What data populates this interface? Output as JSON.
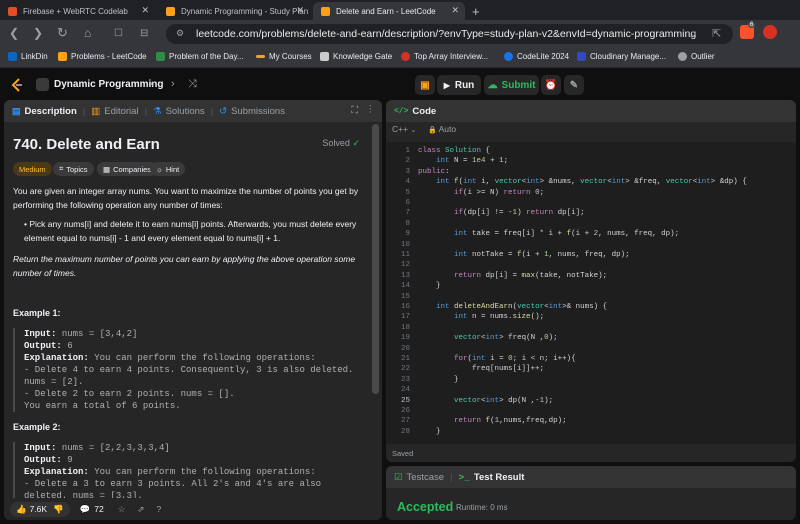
{
  "browser": {
    "tabs": [
      {
        "title": "Firebase + WebRTC Codelab",
        "color": "#e44d26"
      },
      {
        "title": "Dynamic Programming - Study Plan",
        "color": "#ffa116"
      },
      {
        "title": "Delete and Earn - LeetCode",
        "color": "#ffa116"
      }
    ],
    "new_tab": "+",
    "url": "leetcode.com/problems/delete-and-earn/description/?envType=study-plan-v2&envId=dynamic-programming",
    "bookmarks": [
      {
        "label": "LinkDin",
        "color": "#0a66c2"
      },
      {
        "label": "Problems - LeetCode",
        "color": "#ffa116"
      },
      {
        "label": "Problem of the Day...",
        "color": "#2f8d46"
      },
      {
        "label": "My Courses",
        "color": "#e8a33d"
      },
      {
        "label": "Knowledge Gate",
        "color": "#cccccc"
      },
      {
        "label": "Top Array Interview...",
        "color": "#d93025"
      },
      {
        "label": "CodeLite 2024",
        "color": "#1a73e8"
      },
      {
        "label": "Cloudinary Manage...",
        "color": "#3448c5"
      },
      {
        "label": "Outlier",
        "color": "#9aa0a6"
      }
    ],
    "ext_badge": "6"
  },
  "header": {
    "list_name": "Dynamic Programming",
    "run_label": "Run",
    "submit_label": "Submit"
  },
  "desc_panel": {
    "tabs": [
      "Description",
      "Editorial",
      "Solutions",
      "Submissions"
    ],
    "title": "740. Delete and Earn",
    "solved": "Solved",
    "tags": [
      "Medium",
      "Topics",
      "Companies",
      "Hint"
    ],
    "footer": {
      "likes": "7.6K",
      "comments": "72"
    }
  },
  "code_panel": {
    "title": "Code",
    "language": "C++",
    "mode": "Auto",
    "saved": "Saved"
  },
  "result_panel": {
    "tabs": [
      "Testcase",
      "Test Result"
    ],
    "status": "Accepted",
    "runtime": "Runtime: 0 ms"
  }
}
